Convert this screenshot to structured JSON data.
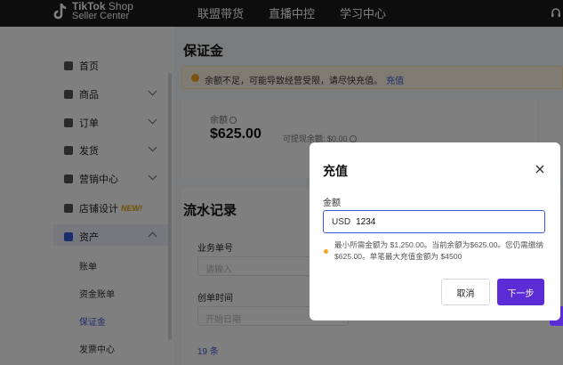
{
  "topbar": {
    "logo_line1_bold": "TikTok",
    "logo_line1_rest": " Shop",
    "logo_line2": "Seller Center",
    "nav": [
      "联盟带货",
      "直播中控",
      "学习中心"
    ],
    "icons": {
      "logo": "tiktok-logo",
      "support": "headset-icon"
    }
  },
  "sidebar": {
    "items": [
      {
        "label": "首页",
        "icon": "home-icon"
      },
      {
        "label": "商品",
        "icon": "product-icon"
      },
      {
        "label": "订单",
        "icon": "order-icon"
      },
      {
        "label": "发货",
        "icon": "shipping-icon"
      },
      {
        "label": "营销中心",
        "icon": "megaphone-icon"
      },
      {
        "label": "店铺设计",
        "icon": "store-icon",
        "badge": "NEW!"
      },
      {
        "label": "资产",
        "icon": "wallet-icon"
      }
    ],
    "sub_items": [
      "账单",
      "资金账单",
      "保证金",
      "发票中心"
    ]
  },
  "main": {
    "title": "保证金",
    "alert": {
      "text": "余额不足，可能导致经营受限，请尽快充值。",
      "link": "充值"
    },
    "balance": {
      "label": "余额",
      "value": "$625.00",
      "available": "可提现余额: $0.00"
    },
    "records": {
      "title": "流水记录",
      "field1_label": "业务单号",
      "field1_placeholder": "请输入",
      "field2_label": "创单时间",
      "field2_placeholder": "开始日期",
      "count": "19 条"
    }
  },
  "modal": {
    "title": "充值",
    "amount_label": "金额",
    "currency": "USD",
    "amount_value": "1234",
    "hint": "最小所需金额为 $1,250.00。当前余额为$625.00。您仍需缴纳 $625.00。单笔最大充值金额为 $4500",
    "cancel": "取消",
    "next": "下一步"
  },
  "colors": {
    "accent": "#5b2cd6",
    "link": "#3b5bd6",
    "warning": "#f5a623",
    "topbar": "#1a1a1a"
  }
}
